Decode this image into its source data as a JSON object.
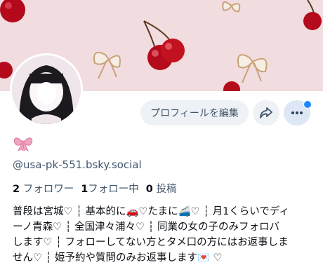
{
  "profile": {
    "display_name_emoji": "ribbon-icon",
    "handle": "@usa-pk-551.bsky.social",
    "followers_count": "2",
    "followers_label": "フォロワー",
    "following_count": "1",
    "following_label": "フォロー中",
    "posts_count": "0",
    "posts_label": "投稿",
    "bio_lines": [
      "普段は宮城♡ ┆ 基本的に🚗♡たまに🚄♡ ┆ 月1くらいでディ",
      "ーノ青森♡ ┆ 全国津々浦々♡ ┆ 同業の女の子のみフォロバ",
      "します♡ ┆ フォローしてない方とタメ口の方にはお返事しま",
      "せん♡ ┆ 姫予約や質問のみお返事します💌 ♡"
    ]
  },
  "actions": {
    "edit_profile_label": "プロフィールを編集",
    "share_icon": "share-icon",
    "more_icon": "more-dots-icon"
  },
  "colors": {
    "banner_bg": "#f1dcdf",
    "button_bg": "#eef1f5",
    "more_button_bg": "#dde7f6",
    "accent": "#208bfe",
    "secondary_text": "#42576c"
  }
}
